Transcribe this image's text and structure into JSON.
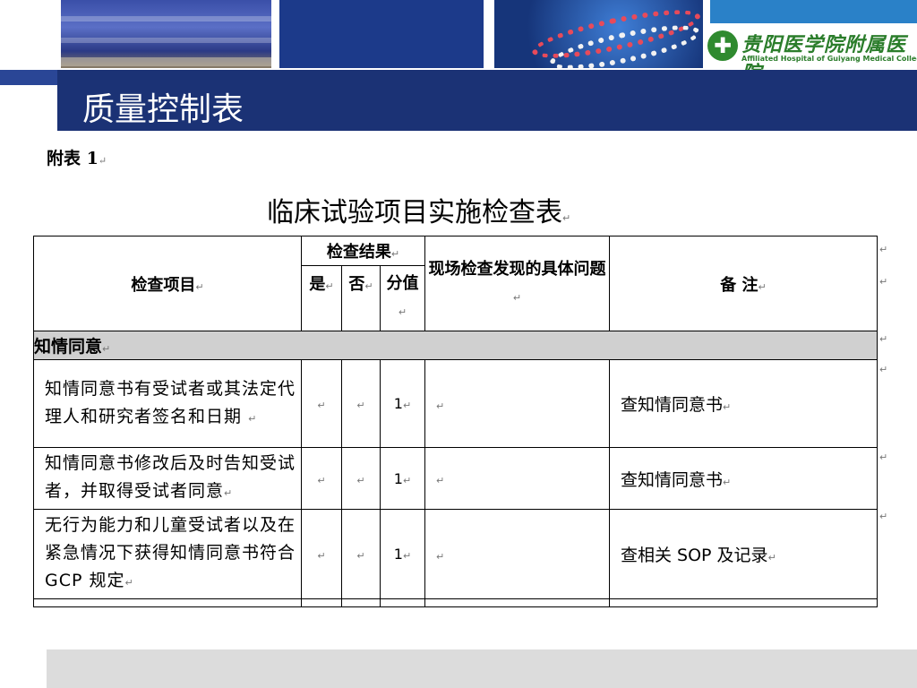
{
  "header": {
    "logo_cn": "贵阳医学院附属医院",
    "logo_en": "Affiliated Hospital of Guiyang Medical College",
    "logo_symbol": "cross-logo-icon"
  },
  "page_title": "质量控制表",
  "annex_label": "附表 1",
  "paragraph_mark": "↵",
  "doc_title": "临床试验项目实施检查表",
  "table": {
    "col_item": "检查项目",
    "col_result": "检查结果",
    "col_yes": "是",
    "col_no": "否",
    "col_score": "分值",
    "col_findings": "现场检查发现的具体问题",
    "col_remark": "备 注",
    "section": "知情同意",
    "rows": [
      {
        "item": "知情同意书有受试者或其法定代理人和研究者签名和日期",
        "score": "1",
        "remark": "查知情同意书"
      },
      {
        "item": "知情同意书修改后及时告知受试者，并取得受试者同意",
        "score": "1",
        "remark": "查知情同意书"
      },
      {
        "item": "无行为能力和儿童受试者以及在紧急情况下获得知情同意书符合 GCP 规定",
        "score": "1",
        "remark": "查相关 SOP 及记录"
      }
    ]
  },
  "colors": {
    "navy": "#1b3275",
    "section_gray": "#d0d0d0",
    "logo_green": "#2b7d2b"
  }
}
